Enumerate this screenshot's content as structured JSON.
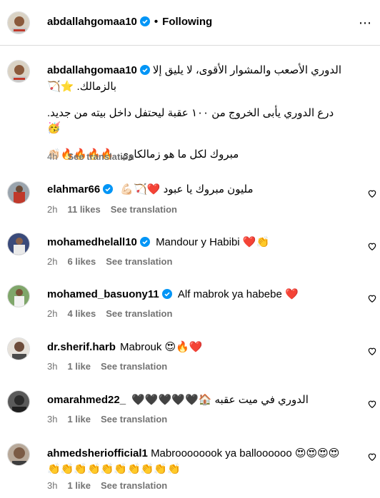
{
  "header": {
    "username": "abdallahgomaa10",
    "separator": "•",
    "follow_status": "Following",
    "more": "⋯"
  },
  "caption": {
    "username": "abdallahgomaa10",
    "line1": "الدوري الأصعب والمشوار الأقوى، لا يليق إلا",
    "line2": "بالزمالك. ⭐🏹",
    "line3": "درع الدوري يأبى الخروج من ١٠٠ عقبة ليحتفل داخل بيته من جديد. 🥳",
    "line4": "مبروك لكل ما هو زمالكاوي، 🔥🔥🔥🔥👏🏻",
    "time": "4h",
    "see_translation": "See translation"
  },
  "comments": [
    {
      "username": "elahmar66",
      "verified": true,
      "text": "مليون مبروك يا عبود ❤️🏹💪🏻",
      "time": "2h",
      "likes": "11 likes",
      "see_translation": "See translation"
    },
    {
      "username": "mohamedhelall10",
      "verified": true,
      "text": "Mandour y Habibi ❤️👏",
      "time": "2h",
      "likes": "6 likes",
      "see_translation": "See translation"
    },
    {
      "username": "mohamed_basuony11",
      "verified": true,
      "text": "Alf mabrok ya habebe ❤️",
      "time": "2h",
      "likes": "4 likes",
      "see_translation": "See translation"
    },
    {
      "username": "dr.sherif.harb",
      "verified": false,
      "text": "Mabrouk 😍🔥❤️",
      "time": "3h",
      "likes": "1 like",
      "see_translation": "See translation"
    },
    {
      "username": "omarahmed22_",
      "verified": false,
      "text": "الدوري في ميت عقبه 🏠🖤🖤🖤🖤🖤",
      "time": "3h",
      "likes": "1 like",
      "see_translation": "See translation"
    },
    {
      "username": "ahmedsheriofficial1",
      "verified": false,
      "text": "Mabroooooook ya balloooooo 😍😍😍😍",
      "text2": "👏👏👏👏👏👏👏👏👏👏",
      "time": "3h",
      "likes": "1 like",
      "see_translation": "See translation"
    }
  ],
  "colors": {
    "verified_blue": "#0095f6",
    "muted": "#737373",
    "divider": "#dbdbdb"
  }
}
